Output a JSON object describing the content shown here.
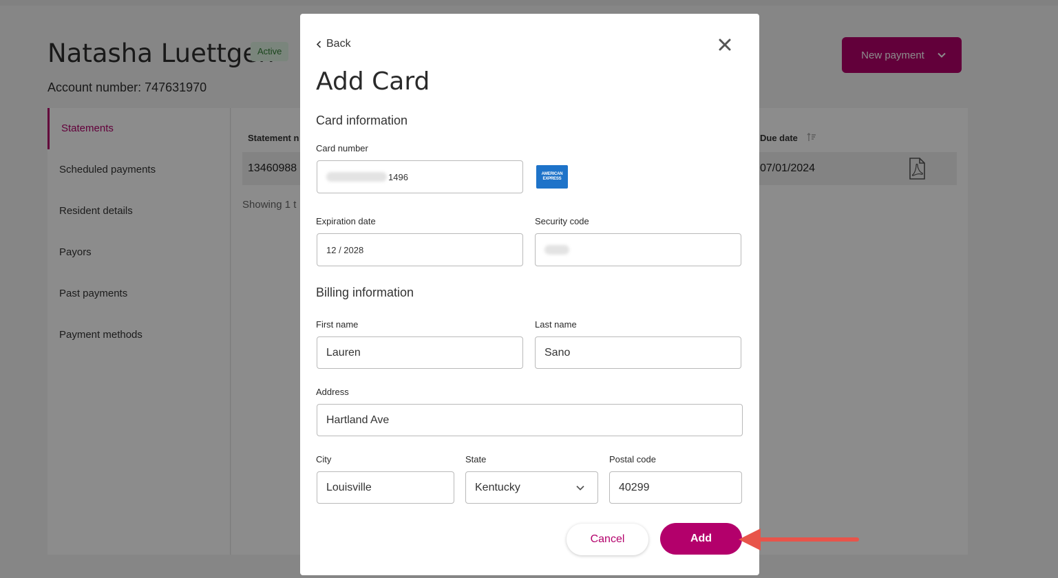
{
  "page": {
    "resident_name": "Natasha Luettgen",
    "status": "Active",
    "account_number": "Account number: 747631970",
    "new_payment_label": "New payment"
  },
  "sidebar": {
    "items": [
      {
        "label": "Statements",
        "active": true
      },
      {
        "label": "Scheduled payments"
      },
      {
        "label": "Resident details"
      },
      {
        "label": "Payors"
      },
      {
        "label": "Past payments"
      },
      {
        "label": "Payment methods"
      }
    ]
  },
  "statements": {
    "columns": {
      "statement_number": "Statement n",
      "due_date": "Due date"
    },
    "row": {
      "statement_number": "13460988",
      "due_date": "07/01/2024"
    },
    "showing": "Showing 1 t"
  },
  "modal": {
    "back_label": "Back",
    "title": "Add Card",
    "card_section": "Card information",
    "card_number_label": "Card number",
    "card_number_last4": "1496",
    "card_brand": "AMERICAN EXPRESS",
    "expiration_label": "Expiration date",
    "expiration_value": "12 / 2028",
    "security_label": "Security code",
    "billing_section": "Billing information",
    "first_name_label": "First name",
    "first_name_value": "Lauren",
    "last_name_label": "Last name",
    "last_name_value": "Sano",
    "address_label": "Address",
    "address_value": "Hartland Ave",
    "city_label": "City",
    "city_value": "Louisville",
    "state_label": "State",
    "state_value": "Kentucky",
    "postal_label": "Postal code",
    "postal_value": "40299",
    "cancel_label": "Cancel",
    "add_label": "Add"
  },
  "colors": {
    "brand": "#b3006b",
    "annotation_arrow": "#e8544a"
  }
}
